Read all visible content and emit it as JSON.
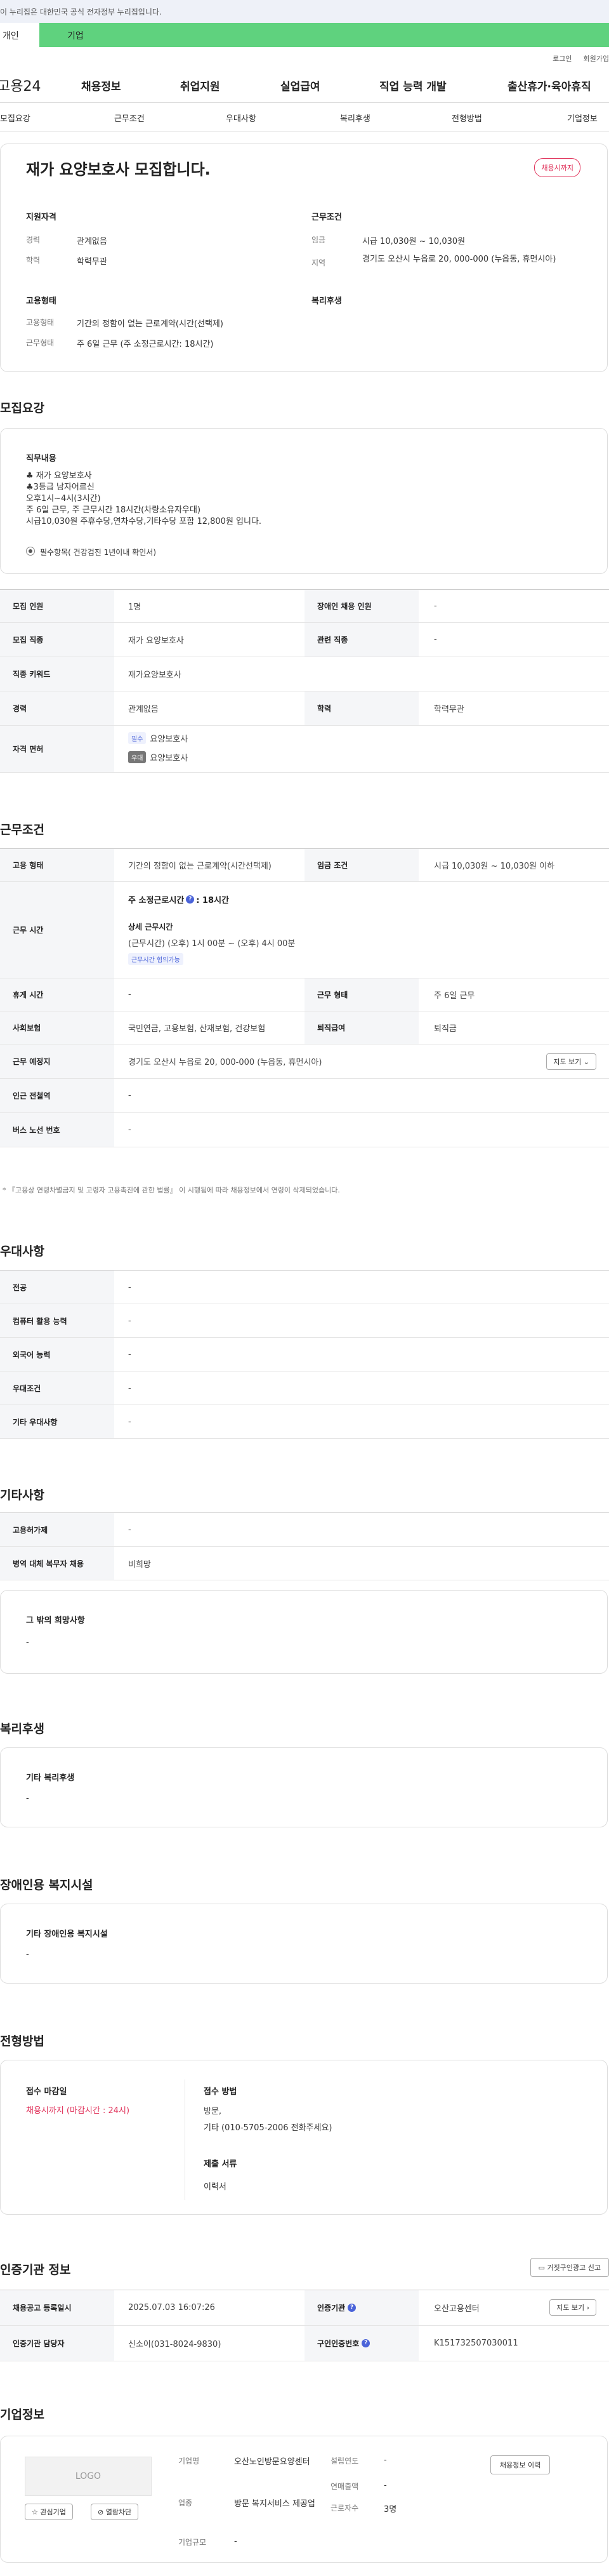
{
  "banner": "이 누리집은 대한민국 공식 전자정부 누리집입니다.",
  "tabs": {
    "personal": "개인",
    "company": "기업"
  },
  "util": {
    "login": "로그인",
    "join": "회원가입"
  },
  "logo": "고용24",
  "gnb": [
    "채용정보",
    "취업지원",
    "실업급여",
    "직업 능력 개발",
    "출산휴가·육아휴직"
  ],
  "snb": [
    "모집요강",
    "근무조건",
    "우대사항",
    "복리후생",
    "전형방법",
    "기업정보"
  ],
  "job": {
    "title": "재가 요양보호사 모집합니다.",
    "badge": "채용시까지",
    "qual_title": "지원자격",
    "career_k": "경력",
    "career_v": "관계없음",
    "edu_k": "학력",
    "edu_v": "학력무관",
    "cond_title": "근무조건",
    "wage_k": "임금",
    "wage_v": "시급 10,030원 ~ 10,030원",
    "area_k": "지역",
    "area_v": "경기도 오산시 누읍로 20, 000-000 (누읍동, 휴먼시아)",
    "emp_title": "고용형태",
    "type_k": "고용형태",
    "type_v": "기간의 정함이 없는 근로계약(시간(선택제)",
    "work_k": "근무형태",
    "work_v": "주 6일 근무 (주 소정근로시간: 18시간)",
    "welfare_title": "복리후생"
  },
  "recruit": {
    "section": "모집요강",
    "duty_title": "직무내용",
    "duty_text": "♣ 재가 요양보호사\n♣3등급 남자어르신\n  오후1시~4시(3시간)\n주 6일 근무, 주 근무시간 18시간(차량소유자우대)\n시급10,030원 주휴수당,연차수당,기타수당 포함 12,800원 입니다.",
    "radio": "필수항목(  건강검진 1년이내 확인서)",
    "rows": {
      "r1": [
        "모집 인원",
        "1명",
        "장애인 채용 인원",
        "-"
      ],
      "r2": [
        "모집 직종",
        "재가 요양보호사",
        "관련 직종",
        "-"
      ],
      "r3": [
        "직종 키워드",
        "재가요양보호사"
      ],
      "r4": [
        "경력",
        "관계없음",
        "학력",
        "학력무관"
      ],
      "r5k": "자격 면허",
      "lic1_tag": "필수",
      "lic1": "요양보호사",
      "lic2_tag": "우대",
      "lic2": "요양보호사"
    }
  },
  "workcond": {
    "section": "근무조건",
    "type": [
      "고용 형태",
      "기간의 정함이 없는 근로계약(시간선택제)",
      "임금 조건",
      "시급 10,030원 ~ 10,030원 이하"
    ],
    "time_k": "근무 시간",
    "weekly": "주 소정근로시간",
    "weekly_v": ": 18시간",
    "detail_title": "상세 근무시간",
    "detail_v": "(근무시간) (오후) 1시 00분 ~ (오후) 4시 00분",
    "flex": "근무시간 협의가능",
    "rest": [
      "휴게 시간",
      "-",
      "근무 형태",
      "주 6일 근무"
    ],
    "ins": [
      "사회보험",
      "국민연금, 고용보험, 산재보험, 건강보험",
      "퇴직급여",
      "퇴직금"
    ],
    "place": [
      "근무 예정지",
      "경기도 오산시 누읍로 20, 000-000 (누읍동, 휴먼시아)"
    ],
    "map_btn": "지도 보기",
    "subway": [
      "인근 전철역",
      "-"
    ],
    "bus": [
      "버스 노선 번호",
      "-"
    ],
    "note": "* 『고용상 연령차별금지 및 고령자 고용촉진에 관한 법률』 이 시행됨에 따라 채용정보에서 연령이 삭제되었습니다."
  },
  "pref": {
    "section": "우대사항",
    "rows": [
      [
        "전공",
        "-"
      ],
      [
        "컴퓨터 활용 능력",
        "-"
      ],
      [
        "외국어 능력",
        "-"
      ],
      [
        "우대조건",
        "-"
      ],
      [
        "기타 우대사항",
        "-"
      ]
    ]
  },
  "etc": {
    "section": "기타사항",
    "rows": [
      [
        "고용허가제",
        "-"
      ],
      [
        "병역 대체 복무자 채용",
        "비희망"
      ]
    ],
    "box_title": "그 밖의 희망사항",
    "box_v": "-"
  },
  "benefit": {
    "section": "복리후생",
    "box_title": "기타 복리후생",
    "box_v": "-"
  },
  "disab": {
    "section": "장애인용 복지시설",
    "box_title": "기타 장애인용 복지시설",
    "box_v": "-"
  },
  "select": {
    "section": "전형방법",
    "deadline_title": "접수 마감일",
    "deadline_v": "채용시까지 (마감시간 : 24시)",
    "method_title": "접수 방법",
    "method_v": "방문,\n기타 (010-5705-2006 전화주세요)",
    "docs_title": "제출 서류",
    "docs_v": "이력서"
  },
  "cert": {
    "section": "인증기관 정보",
    "report_btn": "거짓구인광고 신고",
    "r1": [
      "채용공고 등록일시",
      "2025.07.03 16:07:26",
      "인증기관",
      "오산고용센터"
    ],
    "r2": [
      "인증기관 담당자",
      "신소이(031-8024-9830)",
      "구인인증번호",
      "K151732507030011"
    ],
    "map_btn": "지도 보기"
  },
  "company": {
    "section": "기업정보",
    "logo": "LOGO",
    "fav": "관심기업",
    "block": "열람차단",
    "name_k": "기업명",
    "name_v": "오산노인방문요양센터",
    "ind_k": "업종",
    "ind_v": "방문 복지서비스 제공업",
    "size_k": "기업규모",
    "size_v": "-",
    "est_k": "설립연도",
    "est_v": "-",
    "sales_k": "연매출액",
    "sales_v": "-",
    "emp_k": "근로자수",
    "emp_v": "3명",
    "info_btn": "채용정보 이력"
  }
}
